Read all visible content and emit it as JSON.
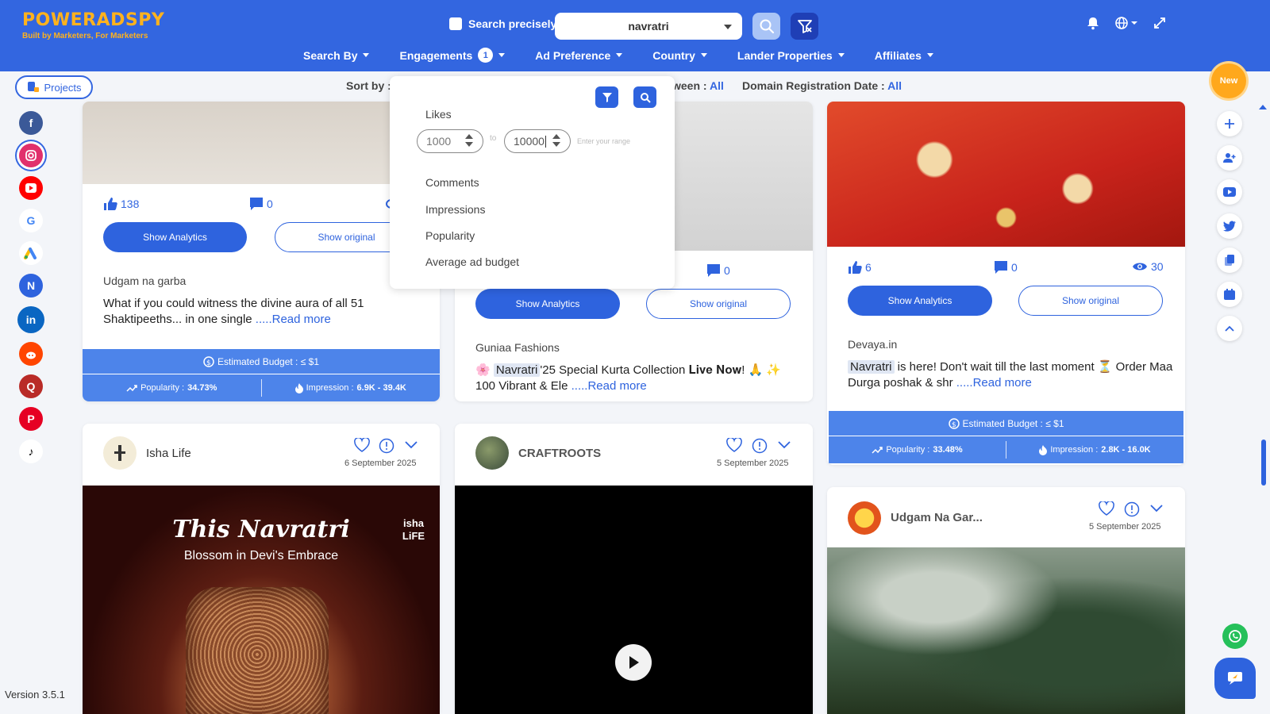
{
  "header": {
    "brand": "POWERADSPY",
    "tagline": "Built by Marketers, For Marketers",
    "search_precisely_label": "Search precisely",
    "search_value": "navratri",
    "nav": [
      {
        "label": "Search By"
      },
      {
        "label": "Engagements",
        "badge": "1"
      },
      {
        "label": "Ad Preference"
      },
      {
        "label": "Country"
      },
      {
        "label": "Lander Properties"
      },
      {
        "label": "Affiliates"
      }
    ]
  },
  "toolbar": {
    "projects_label": "Projects",
    "sort_by_label": "Sort by :",
    "between_label": "ween :",
    "between_value": "All",
    "domain_label": "Domain Registration Date :",
    "domain_value": "All"
  },
  "engagement_dropdown": {
    "likes_label": "Likes",
    "likes_min": "1000",
    "likes_max": "10000",
    "to_label": "to",
    "range_hint": "Enter your range",
    "options": [
      "Comments",
      "Impressions",
      "Popularity",
      "Average ad budget"
    ]
  },
  "sidebar": {
    "socials": [
      "facebook",
      "instagram",
      "youtube",
      "google",
      "google-ads",
      "native",
      "linkedin",
      "reddit",
      "quora",
      "pinterest",
      "tiktok"
    ],
    "version": "Version 3.5.1"
  },
  "cards": {
    "c1": {
      "likes": "138",
      "comments": "0",
      "show_analytics": "Show Analytics",
      "show_original": "Show original",
      "advertiser": "Udgam na garba",
      "text": "What if you could witness the divine aura of all 51 Shaktipeeths... in one single ",
      "read_more": ".....Read more",
      "budget": "Estimated Budget : ≤ $1",
      "popularity_label": "Popularity :",
      "popularity": "34.73%",
      "impression_label": "Impression :",
      "impression": "6.9K - 39.4K"
    },
    "c2": {
      "comments": "0",
      "show_analytics": "Show Analytics",
      "show_original": "Show original",
      "advertiser": "Guniaa Fashions",
      "text_hl": "Navratri",
      "text_pre": "🌸 ",
      "text_post": "'25 Special Kurta Collection 𝐋𝐢𝐯𝐞 𝐍𝐨𝐰! 🙏 ✨ 100 Vibrant & Ele ",
      "read_more": ".....Read more"
    },
    "c3": {
      "likes": "6",
      "comments": "0",
      "views": "30",
      "show_analytics": "Show Analytics",
      "show_original": "Show original",
      "advertiser": "Devaya.in",
      "text_hl": "Navratri",
      "text_post": " is here! Don't wait till the last moment ⏳ Order Maa Durga poshak & shr ",
      "read_more": ".....Read more",
      "budget": "Estimated Budget : ≤ $1",
      "popularity_label": "Popularity :",
      "popularity": "33.48%",
      "impression_label": "Impression :",
      "impression": "2.8K - 16.0K"
    },
    "c4": {
      "name": "Isha Life",
      "date": "6 September 2025",
      "creative_title": "This Navratri",
      "creative_subtitle": "Blossom in Devi's Embrace",
      "creative_brand": "isha LiFE"
    },
    "c5": {
      "name": "CRAFTROOTS",
      "date": "5 September 2025"
    },
    "c6": {
      "name": "Udgam Na Gar...",
      "date": "5 September 2025"
    }
  },
  "right_rail": {
    "new_label": "New",
    "icons": [
      "plus-icon",
      "add-user-icon",
      "youtube-icon",
      "twitter-icon",
      "copy-icon",
      "calendar-icon",
      "chevron-up-icon"
    ]
  },
  "colors": {
    "brand_blue": "#3366e0",
    "accent_orange": "#ffb21d",
    "button_blue": "#2e63de"
  }
}
